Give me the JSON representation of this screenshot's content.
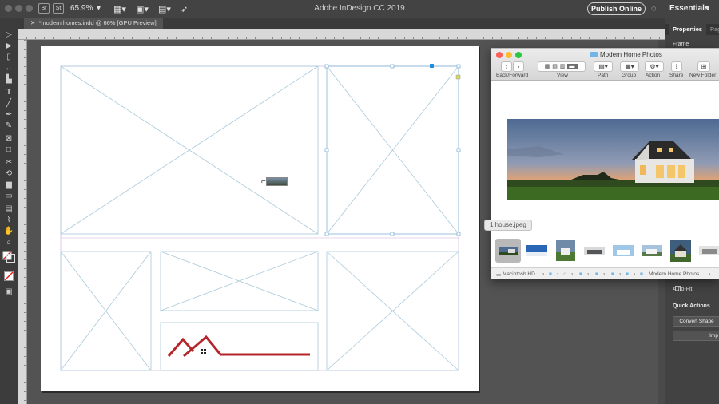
{
  "app": {
    "title": "Adobe InDesign CC 2019",
    "zoom": "65.9%",
    "bridge_badge": "Br",
    "stock_badge": "St",
    "publish_label": "Publish Online",
    "workspace": "Essentials"
  },
  "document_tab": "*modern homes.indd @ 66% [GPU Preview]",
  "tools": [
    "selection-tool",
    "direct-selection-tool",
    "page-tool",
    "gap-tool",
    "content-collector-tool",
    "type-tool",
    "line-tool",
    "pen-tool",
    "pencil-tool",
    "rectangle-frame-tool",
    "rectangle-tool",
    "scissors-tool",
    "free-transform-tool",
    "gradient-swatch-tool",
    "gradient-feather-tool",
    "note-tool",
    "eyedropper-tool",
    "hand-tool",
    "zoom-tool",
    "fill-stroke-swatch",
    "apply-none",
    "screen-mode"
  ],
  "properties_panel": {
    "tab_active": "Properties",
    "tab_other": "Pag",
    "section_label": "Frame",
    "auto_fit": "Auto-Fit",
    "quick_actions": "Quick Actions",
    "convert_shape": "Convert Shape",
    "import_button": "Imp"
  },
  "finder": {
    "title": "Modern Home Photos",
    "toolbar": {
      "back_forward": "Back/Forward",
      "view": "View",
      "path": "Path",
      "group": "Group",
      "action": "Action",
      "share": "Share",
      "new_folder": "New Folder"
    },
    "tooltip": "1 house.jpeg",
    "path": [
      "Macintosh HD",
      "Modern Home Photos"
    ]
  },
  "colors": {
    "logo_red": "#b5262b",
    "frame_line": "#a9c9da",
    "accent_blue": "#1f8fe0"
  }
}
